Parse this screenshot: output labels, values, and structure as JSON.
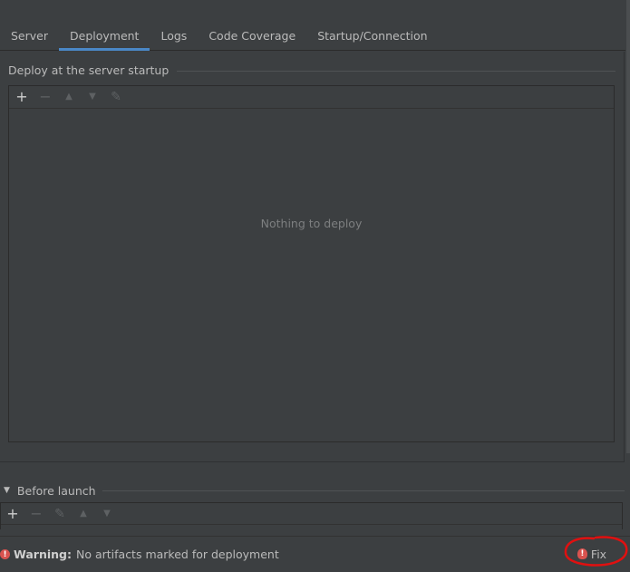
{
  "tabs": [
    {
      "label": "Server"
    },
    {
      "label": "Deployment"
    },
    {
      "label": "Logs"
    },
    {
      "label": "Code Coverage"
    },
    {
      "label": "Startup/Connection"
    }
  ],
  "active_tab": "Deployment",
  "deploy_section": {
    "title": "Deploy at the server startup",
    "toolbar": {
      "add": "+",
      "remove": "−",
      "up": "▲",
      "down": "▼",
      "edit": "✎"
    },
    "empty_text": "Nothing to deploy"
  },
  "before_launch": {
    "title": "Before launch",
    "toolbar": {
      "add": "+",
      "remove": "−",
      "edit": "✎",
      "up": "▲",
      "down": "▼"
    }
  },
  "warning": {
    "icon": "!",
    "label": "Warning:",
    "message": "No artifacts marked for deployment",
    "fix_label": "Fix",
    "fix_icon": "!"
  },
  "colors": {
    "background": "#3c3f41",
    "accent": "#4a88c7",
    "warning": "#d9534f",
    "annotation": "#e01010"
  }
}
